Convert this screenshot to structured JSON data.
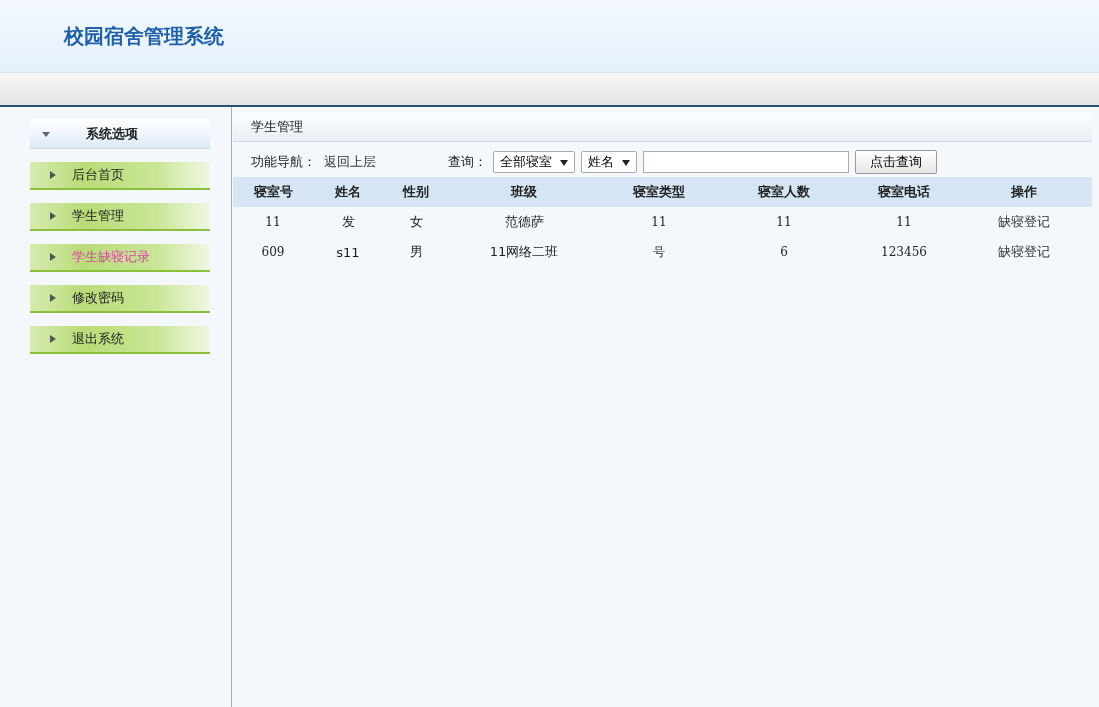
{
  "header": {
    "title": "校园宿舍管理系统"
  },
  "sidebar": {
    "title": "系统选项",
    "expanded": true,
    "items": [
      {
        "label": "后台首页",
        "selected": false
      },
      {
        "label": "学生管理",
        "selected": false
      },
      {
        "label": "学生缺寝记录",
        "selected": true
      },
      {
        "label": "修改密码",
        "selected": false
      },
      {
        "label": "退出系统",
        "selected": false
      }
    ]
  },
  "panel": {
    "title": "学生管理",
    "nav": {
      "label": "功能导航：",
      "link": "返回上层"
    },
    "query": {
      "label": "查询：",
      "dorm_select": "全部寝室",
      "field_select": "姓名",
      "button": "点击查询"
    },
    "table": {
      "columns": [
        "寝室号",
        "姓名",
        "性别",
        "班级",
        "寝室类型",
        "寝室人数",
        "寝室电话",
        "操作"
      ],
      "rows": [
        {
          "cells": [
            "11",
            "发",
            "女",
            "范德萨",
            "11",
            "11",
            "11"
          ],
          "action": "缺寝登记"
        },
        {
          "cells": [
            "609",
            "s11",
            "男",
            "11网络二班",
            "号",
            "6",
            "123456"
          ],
          "action": "缺寝登记"
        }
      ]
    }
  }
}
